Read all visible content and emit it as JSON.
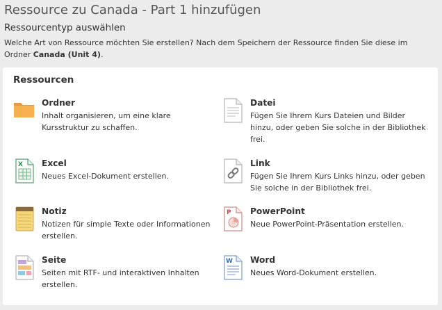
{
  "header": {
    "title": "Ressource zu Canada - Part 1 hinzufügen",
    "subtitle": "Ressourcentyp auswählen",
    "intro_text": "Welche Art von Ressource möchten Sie erstellen? Nach dem Speichern der Ressource finden Sie diese im Ordner ",
    "intro_folder": "Canada (Unit 4)",
    "intro_end": "."
  },
  "panel": {
    "title": "Ressourcen",
    "items": [
      {
        "icon": "folder-icon",
        "name": "Ordner",
        "desc": "Inhalt organisieren, um eine klare Kursstruktur zu schaffen."
      },
      {
        "icon": "file-icon",
        "name": "Datei",
        "desc": "Fügen Sie Ihrem Kurs Dateien und Bilder hinzu, oder geben Sie solche in der Bibliothek frei."
      },
      {
        "icon": "excel-icon",
        "name": "Excel",
        "desc": "Neues Excel-Dokument erstellen."
      },
      {
        "icon": "link-icon",
        "name": "Link",
        "desc": "Fügen Sie Ihrem Kurs Links hinzu, oder geben Sie solche in der Bibliothek frei."
      },
      {
        "icon": "note-icon",
        "name": "Notiz",
        "desc": "Notizen für simple Texte oder Informationen erstellen."
      },
      {
        "icon": "powerpoint-icon",
        "name": "PowerPoint",
        "desc": "Neue PowerPoint-Präsentation erstellen."
      },
      {
        "icon": "page-icon",
        "name": "Seite",
        "desc": "Seiten mit RTF- und interaktiven Inhalten erstellen."
      },
      {
        "icon": "word-icon",
        "name": "Word",
        "desc": "Neues Word-Dokument erstellen."
      }
    ]
  },
  "colors": {
    "folder": "#f0a94a",
    "excel": "#3a9a5b",
    "note": "#e9c46a",
    "powerpoint": "#c0504d",
    "word": "#3b6db3"
  }
}
